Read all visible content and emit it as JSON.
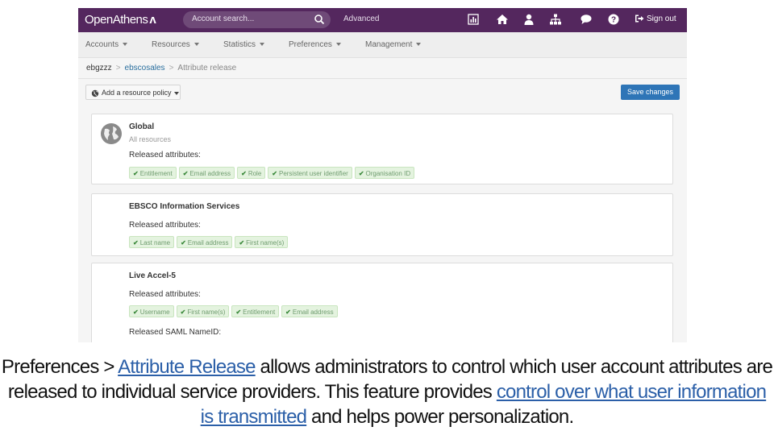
{
  "topbar": {
    "logo_text": "OpenAthens",
    "search_placeholder": "Account search...",
    "advanced_label": "Advanced",
    "icons": [
      "bar-chart-icon",
      "home-icon",
      "user-icon",
      "sitemap-icon",
      "chat-icon",
      "help-icon"
    ],
    "signout_label": "Sign out",
    "colors": {
      "bar": "#54275e",
      "search": "#6f4a78"
    }
  },
  "nav": {
    "items": [
      "Accounts",
      "Resources",
      "Statistics",
      "Preferences",
      "Management"
    ]
  },
  "breadcrumb": {
    "items": [
      "ebgzzz",
      "ebscosales",
      "Attribute release"
    ]
  },
  "toolbar": {
    "add_policy_label": "Add a resource policy",
    "save_label": "Save changes"
  },
  "cards": [
    {
      "title": "Global",
      "subtitle": "All resources",
      "released_label": "Released attributes:",
      "tags": [
        "Entitlement",
        "Email address",
        "Role",
        "Persistent user identifier",
        "Organisation ID"
      ]
    },
    {
      "title": "EBSCO Information Services",
      "released_label": "Released attributes:",
      "tags": [
        "Last name",
        "Email address",
        "First name(s)"
      ]
    },
    {
      "title": "Live Accel-5",
      "released_label": "Released attributes:",
      "tags": [
        "Username",
        "First name(s)",
        "Entitlement",
        "Email address"
      ],
      "saml_label": "Released SAML NameID:"
    }
  ],
  "caption": {
    "p1": "Preferences > ",
    "link1": "Attribute Release",
    "p2": " allows administrators to control which user account attributes are released to individual service providers. This feature provides ",
    "link2": "control over what user information is transmitted",
    "p3": " and helps power personalization."
  }
}
